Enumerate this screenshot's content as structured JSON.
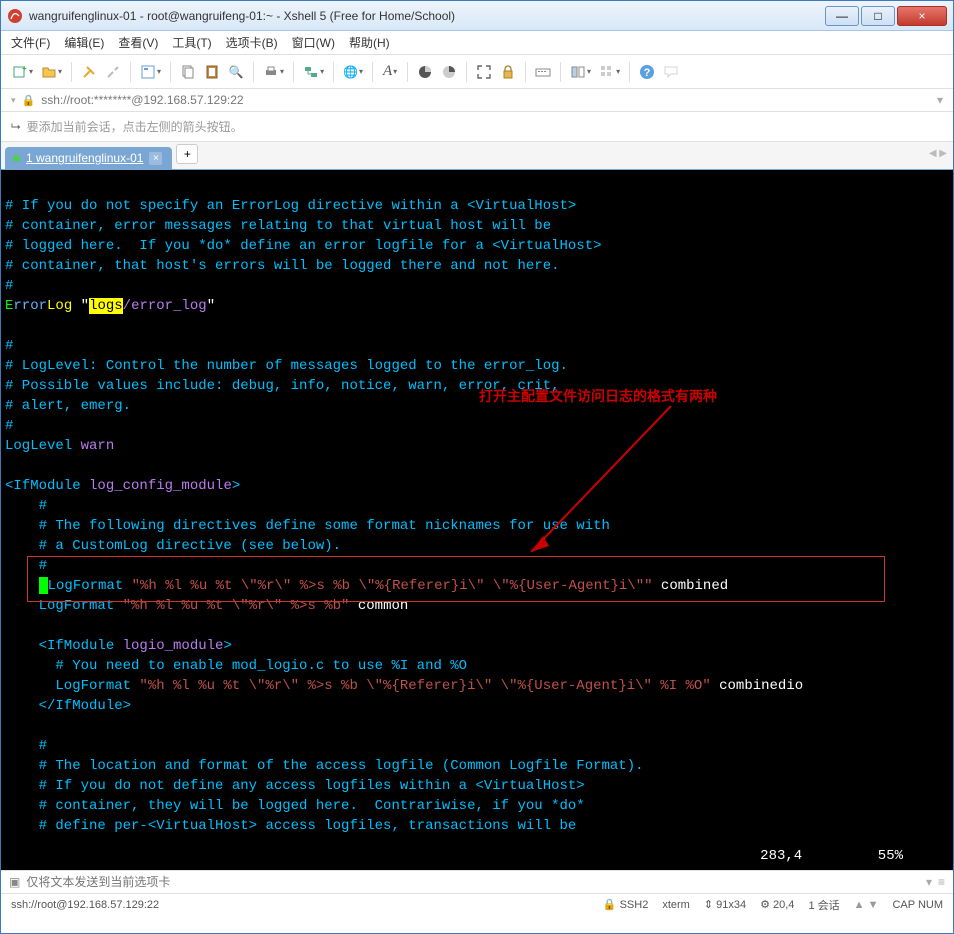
{
  "window": {
    "title": "wangruifenglinux-01 - root@wangruifeng-01:~ - Xshell 5 (Free for Home/School)"
  },
  "menu": {
    "file": "文件(F)",
    "edit": "编辑(E)",
    "view": "查看(V)",
    "tools": "工具(T)",
    "tab": "选项卡(B)",
    "window": "窗口(W)",
    "help": "帮助(H)"
  },
  "addressbar": {
    "value": "ssh://root:********@192.168.57.129:22"
  },
  "hintbar": {
    "text": "要添加当前会话，点击左侧的箭头按钮。"
  },
  "tab": {
    "label": "1 wangruifenglinux-01"
  },
  "terminal": {
    "c1": "# If you do not specify an ErrorLog directive within a <VirtualHost>",
    "c2": "# container, error messages relating to that virtual host will be",
    "c3": "# logged here.  If you *do* define an error logfile for a <VirtualHost>",
    "c4": "# container, that host's errors will be logged there and not here.",
    "c5": "#",
    "errlog_hl": "logs",
    "errlog_rest": "/error_log",
    "c6": "#",
    "c7": "# LogLevel: Control the number of messages logged to the error_log.",
    "c8": "# Possible values include: debug, info, notice, warn, error, crit,",
    "c9": "# alert, emerg.",
    "c10": "#",
    "loglevel": "LogLevel ",
    "loglevel_val": "warn",
    "ifmod_open": "<IfModule ",
    "ifmod_name": "log_config_module",
    "ifmod_close": ">",
    "c11": "    #",
    "c12": "    # The following directives define some format nicknames for use with",
    "c13": "    # a CustomLog directive (see below).",
    "c14": "    #",
    "lf1_key": "LogFormat ",
    "lf1_fmt": "\"%h %l %u %t \\\"%r\\\" %>s %b \\\"%{Referer}i\\\" \\\"%{User-Agent}i\\\"\"",
    "lf1_name": " combined",
    "lf2_key": "    LogFormat ",
    "lf2_fmt": "\"%h %l %u %t \\\"%r\\\" %>s %b\"",
    "lf2_name": " common",
    "ifmod2_open": "    <IfModule ",
    "ifmod2_name": "logio_module",
    "ifmod2_close": ">",
    "c15": "      # You need to enable mod_logio.c to use %I and %O",
    "lf3_key": "      LogFormat ",
    "lf3_fmt": "\"%h %l %u %t \\\"%r\\\" %>s %b \\\"%{Referer}i\\\" \\\"%{User-Agent}i\\\" %I %O\"",
    "lf3_name": " combinedio",
    "ifmod2_end": "    </IfModule>",
    "c16": "    #",
    "c17": "    # The location and format of the access logfile (Common Logfile Format).",
    "c18": "    # If you do not define any access logfiles within a <VirtualHost>",
    "c19": "    # container, they will be logged here.  Contrariwise, if you *do*",
    "c20": "    # define per-<VirtualHost> access logfiles, transactions will be",
    "status": "283,4         55%",
    "annotation": "打开主配置文件访问日志的格式有两种"
  },
  "cmdbar": {
    "placeholder": "仅将文本发送到当前选项卡"
  },
  "status": {
    "left": "ssh://root@192.168.57.129:22",
    "proto": "SSH2",
    "term": "xterm",
    "size": "91x34",
    "enc": "20,4",
    "sess": "1 会话",
    "caps": "CAP  NUM"
  },
  "icons": {
    "lock": "🔒",
    "arrow": "⮡",
    "plus": "+",
    "x": "×",
    "min": "—",
    "max": "□",
    "left": "◀",
    "right": "▶",
    "down": "▾",
    "gear": "⚙",
    "help": "?",
    "search": "🔍",
    "globe": "🌐",
    "font": "A",
    "refresh": "↻"
  }
}
